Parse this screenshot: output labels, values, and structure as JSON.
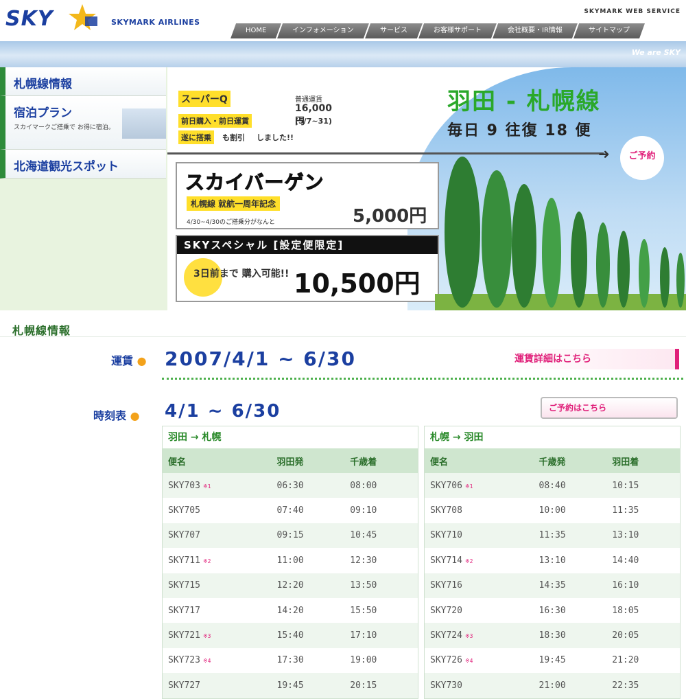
{
  "header": {
    "logo_text": "SKY",
    "logo_sub": "SKYMARK AIRLINES",
    "web_service": "SKYMARK WEB SERVICE",
    "nav": [
      "HOME",
      "インフォメーション",
      "サービス",
      "お客様サポート",
      "会社概要・IR情報",
      "サイトマップ"
    ],
    "tagline": "We are SKY"
  },
  "sidebar": {
    "items": [
      {
        "label": "札幌線情報"
      },
      {
        "label": "宿泊プラン",
        "sub": "スカイマークご搭乗で お得に宿泊。"
      },
      {
        "label": "北海道観光スポット"
      }
    ]
  },
  "hero": {
    "promo1": {
      "tag1": "スーパーQ",
      "text1": "普通運賃",
      "text2": "16,000円",
      "tag2": "前日購入・前日運賃",
      "text3": "(5/7~31)",
      "tag3": "遂に搭乗",
      "text4": "も割引",
      "text5": "しました!!"
    },
    "route_title": "羽田 - 札幌線",
    "route_sub": "毎日 9 往復 18 便",
    "reserve_label": "ご予約",
    "promo2": {
      "title": "スカイバーゲン",
      "sub": "札幌線 就航一周年記念",
      "note": "4/30~4/30のご搭乗分がなんと",
      "price": "5,000円"
    },
    "promo3": {
      "head": "SKYスペシャル [設定便限定]",
      "small": "3日前まで 購入可能!!",
      "price": "10,500円~"
    }
  },
  "main": {
    "section_title": "札幌線情報",
    "fare_label": "運賃",
    "fare_date": "2007/4/1 ~ 6/30",
    "fare_link": "運賃詳細はこちら",
    "timetable_label": "時刻表",
    "timetable_date": "4/1 ~ 6/30",
    "reserve_link": "ご予約はこちら"
  },
  "timetable_left": {
    "direction": "羽田 → 札幌",
    "headers": [
      "便名",
      "羽田発",
      "千歳着"
    ],
    "rows": [
      {
        "flight": "SKY703",
        "note": "※1",
        "dep": "06:30",
        "arr": "08:00"
      },
      {
        "flight": "SKY705",
        "note": "",
        "dep": "07:40",
        "arr": "09:10"
      },
      {
        "flight": "SKY707",
        "note": "",
        "dep": "09:15",
        "arr": "10:45"
      },
      {
        "flight": "SKY711",
        "note": "※2",
        "dep": "11:00",
        "arr": "12:30"
      },
      {
        "flight": "SKY715",
        "note": "",
        "dep": "12:20",
        "arr": "13:50"
      },
      {
        "flight": "SKY717",
        "note": "",
        "dep": "14:20",
        "arr": "15:50"
      },
      {
        "flight": "SKY721",
        "note": "※3",
        "dep": "15:40",
        "arr": "17:10"
      },
      {
        "flight": "SKY723",
        "note": "※4",
        "dep": "17:30",
        "arr": "19:00"
      },
      {
        "flight": "SKY727",
        "note": "",
        "dep": "19:45",
        "arr": "20:15"
      }
    ]
  },
  "timetable_right": {
    "direction": "札幌 → 羽田",
    "headers": [
      "便名",
      "千歳発",
      "羽田着"
    ],
    "rows": [
      {
        "flight": "SKY706",
        "note": "※1",
        "dep": "08:40",
        "arr": "10:15"
      },
      {
        "flight": "SKY708",
        "note": "",
        "dep": "10:00",
        "arr": "11:35"
      },
      {
        "flight": "SKY710",
        "note": "",
        "dep": "11:35",
        "arr": "13:10"
      },
      {
        "flight": "SKY714",
        "note": "※2",
        "dep": "13:10",
        "arr": "14:40"
      },
      {
        "flight": "SKY716",
        "note": "",
        "dep": "14:35",
        "arr": "16:10"
      },
      {
        "flight": "SKY720",
        "note": "",
        "dep": "16:30",
        "arr": "18:05"
      },
      {
        "flight": "SKY724",
        "note": "※3",
        "dep": "18:30",
        "arr": "20:05"
      },
      {
        "flight": "SKY726",
        "note": "※4",
        "dep": "19:45",
        "arr": "21:20"
      },
      {
        "flight": "SKY730",
        "note": "",
        "dep": "21:00",
        "arr": "22:35"
      }
    ]
  }
}
